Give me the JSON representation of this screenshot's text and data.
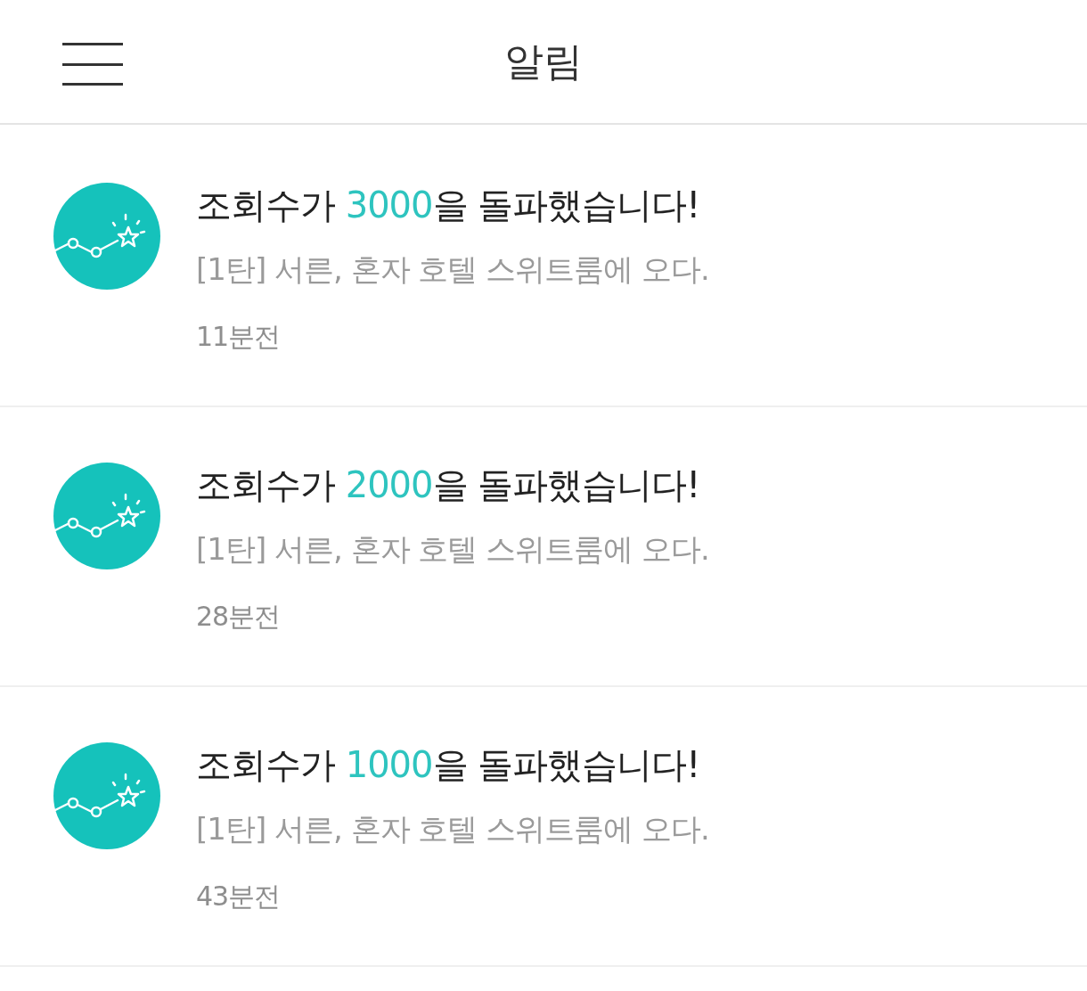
{
  "header": {
    "title": "알림"
  },
  "notifications": [
    {
      "title_before": "조회수가 ",
      "count": "3000",
      "title_after": "을 돌파했습니다!",
      "post": "[1탄] 서른, 혼자 호텔 스위트룸에 오다.",
      "time": "11분전"
    },
    {
      "title_before": "조회수가 ",
      "count": "2000",
      "title_after": "을 돌파했습니다!",
      "post": "[1탄] 서른, 혼자 호텔 스위트룸에 오다.",
      "time": "28분전"
    },
    {
      "title_before": "조회수가 ",
      "count": "1000",
      "title_after": "을 돌파했습니다!",
      "post": "[1탄] 서른, 혼자 호텔 스위트룸에 오다.",
      "time": "43분전"
    }
  ]
}
